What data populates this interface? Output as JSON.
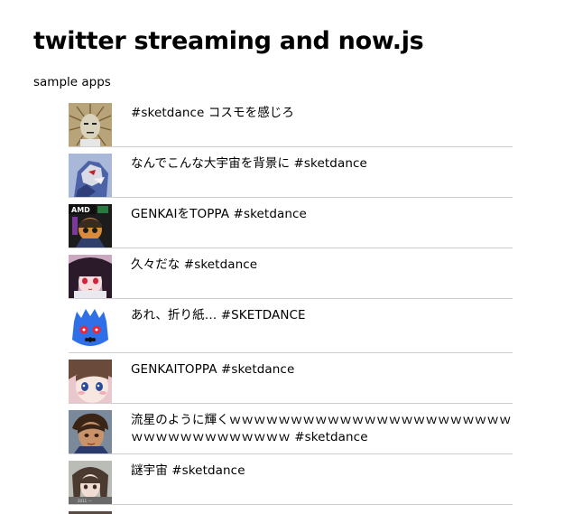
{
  "page": {
    "title": "twitter streaming and now.js",
    "subtitle": "sample apps"
  },
  "tweets": [
    {
      "text": "#sketdance コスモを感じろ",
      "avatar": "avatar-1"
    },
    {
      "text": "なんでこんな大宇宙を背景に #sketdance",
      "avatar": "avatar-2"
    },
    {
      "text": "GENKAIをTOPPA #sketdance",
      "avatar": "avatar-3"
    },
    {
      "text": "久々だな #sketdance",
      "avatar": "avatar-4"
    },
    {
      "text": "あれ、折り紙… #SKETDANCE",
      "avatar": "avatar-5"
    },
    {
      "text": "GENKAITOPPA #sketdance",
      "avatar": "avatar-6"
    },
    {
      "text": "流星のように輝くｗｗｗｗｗｗｗｗｗｗｗｗｗｗｗｗｗｗｗｗｗｗｗｗｗｗｗｗｗｗｗｗｗｗｗｗ #sketdance",
      "avatar": "avatar-7"
    },
    {
      "text": "謎宇宙 #sketdance",
      "avatar": "avatar-8"
    }
  ]
}
